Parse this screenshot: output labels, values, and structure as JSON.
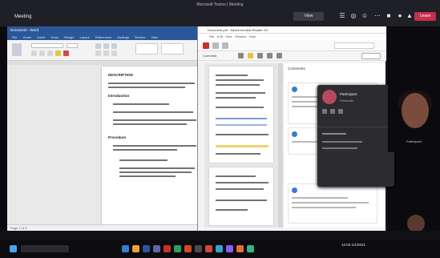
{
  "meeting": {
    "window_title": "Microsoft Teams | Meeting",
    "meeting_name": "Meeting",
    "view_label": "View",
    "leave_label": "Leave",
    "participant_name": "Participant",
    "participant_card_name": "Participant",
    "participant_card_status": "Presenter"
  },
  "word": {
    "title": "Document - Word",
    "tabs": [
      "File",
      "Home",
      "Insert",
      "Draw",
      "Design",
      "Layout",
      "References",
      "Mailings",
      "Review",
      "View"
    ],
    "heading": "DESCRIPTION",
    "section1": "Introduction",
    "section2": "Procedure",
    "status": "Page 1 of 3"
  },
  "pdf": {
    "title": "Document.pdf - Adobe Acrobat Reader DC",
    "menu": [
      "File",
      "Edit",
      "View",
      "Window",
      "Help"
    ],
    "comment_label": "Comment",
    "comments_header": "Comments"
  },
  "taskbar": {
    "time": "12:00",
    "date": "1/1/2021"
  },
  "colors": {
    "word_blue": "#2b579a",
    "leave_red": "#c4314b",
    "teams_bar": "#1f1f26"
  }
}
